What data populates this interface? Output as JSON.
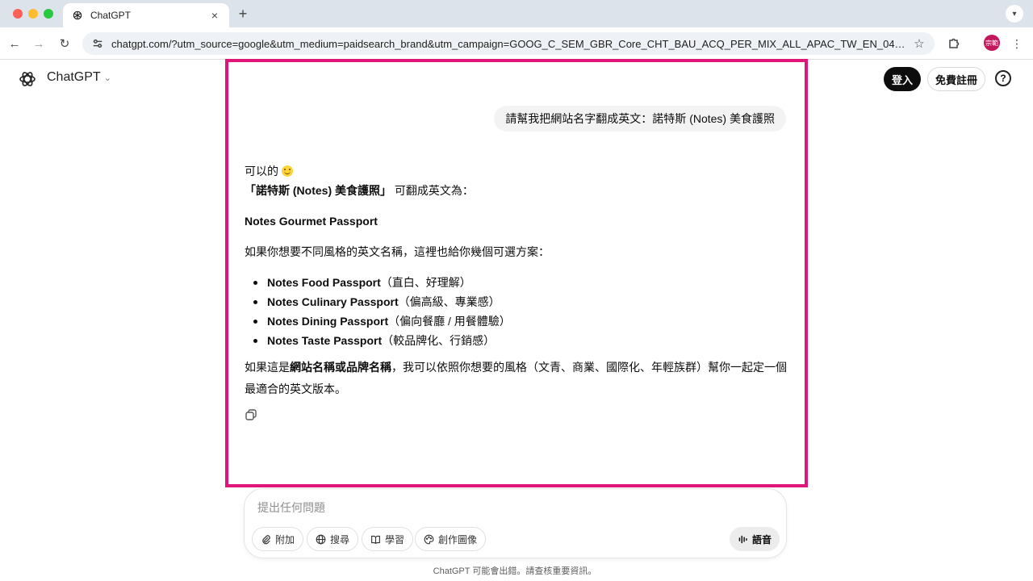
{
  "browser": {
    "tab_title": "ChatGPT",
    "tab_close": "×",
    "new_tab": "+",
    "url": "chatgpt.com/?utm_source=google&utm_medium=paidsearch_brand&utm_campaign=GOOG_C_SEM_GBR_Core_CHT_BAU_ACQ_PER_MIX_ALL_APAC_TW_EN_04222...",
    "profile_initials": "宗範"
  },
  "header": {
    "model_name": "ChatGPT",
    "login_label": "登入",
    "signup_label": "免費註冊",
    "help_label": "?"
  },
  "conversation": {
    "user_message": "請幫我把網站名字翻成英文：諾特斯 (Notes) 美食護照",
    "assistant": {
      "greeting": "可以的",
      "name_bold": "「諾特斯 (Notes) 美食護照」",
      "name_suffix": " 可翻成英文為：",
      "main_translation": "Notes Gourmet Passport",
      "alt_intro": "如果你想要不同風格的英文名稱，這裡也給你幾個可選方案：",
      "options": [
        {
          "name": "Notes Food Passport",
          "note": "（直白、好理解）"
        },
        {
          "name": "Notes Culinary Passport",
          "note": "（偏高級、專業感）"
        },
        {
          "name": "Notes Dining Passport",
          "note": "（偏向餐廳 / 用餐體驗）"
        },
        {
          "name": "Notes Taste Passport",
          "note": "（較品牌化、行銷感）"
        }
      ],
      "final_prefix": "如果這是",
      "final_bold": "網站名稱或品牌名稱",
      "final_suffix": "，我可以依照你想要的風格（文青、商業、國際化、年輕族群）幫你一起定一個最適合的英文版本。"
    }
  },
  "composer": {
    "placeholder": "提出任何問題",
    "attach_label": "附加",
    "search_label": "搜尋",
    "study_label": "學習",
    "image_label": "創作圖像",
    "voice_label": "語音"
  },
  "footer": {
    "disclaimer": "ChatGPT 可能會出錯。請查核重要資訊。"
  },
  "colors": {
    "highlight_border": "#e0157a",
    "profile_bg": "#c2185b",
    "primary_button": "#0d0d0d"
  }
}
